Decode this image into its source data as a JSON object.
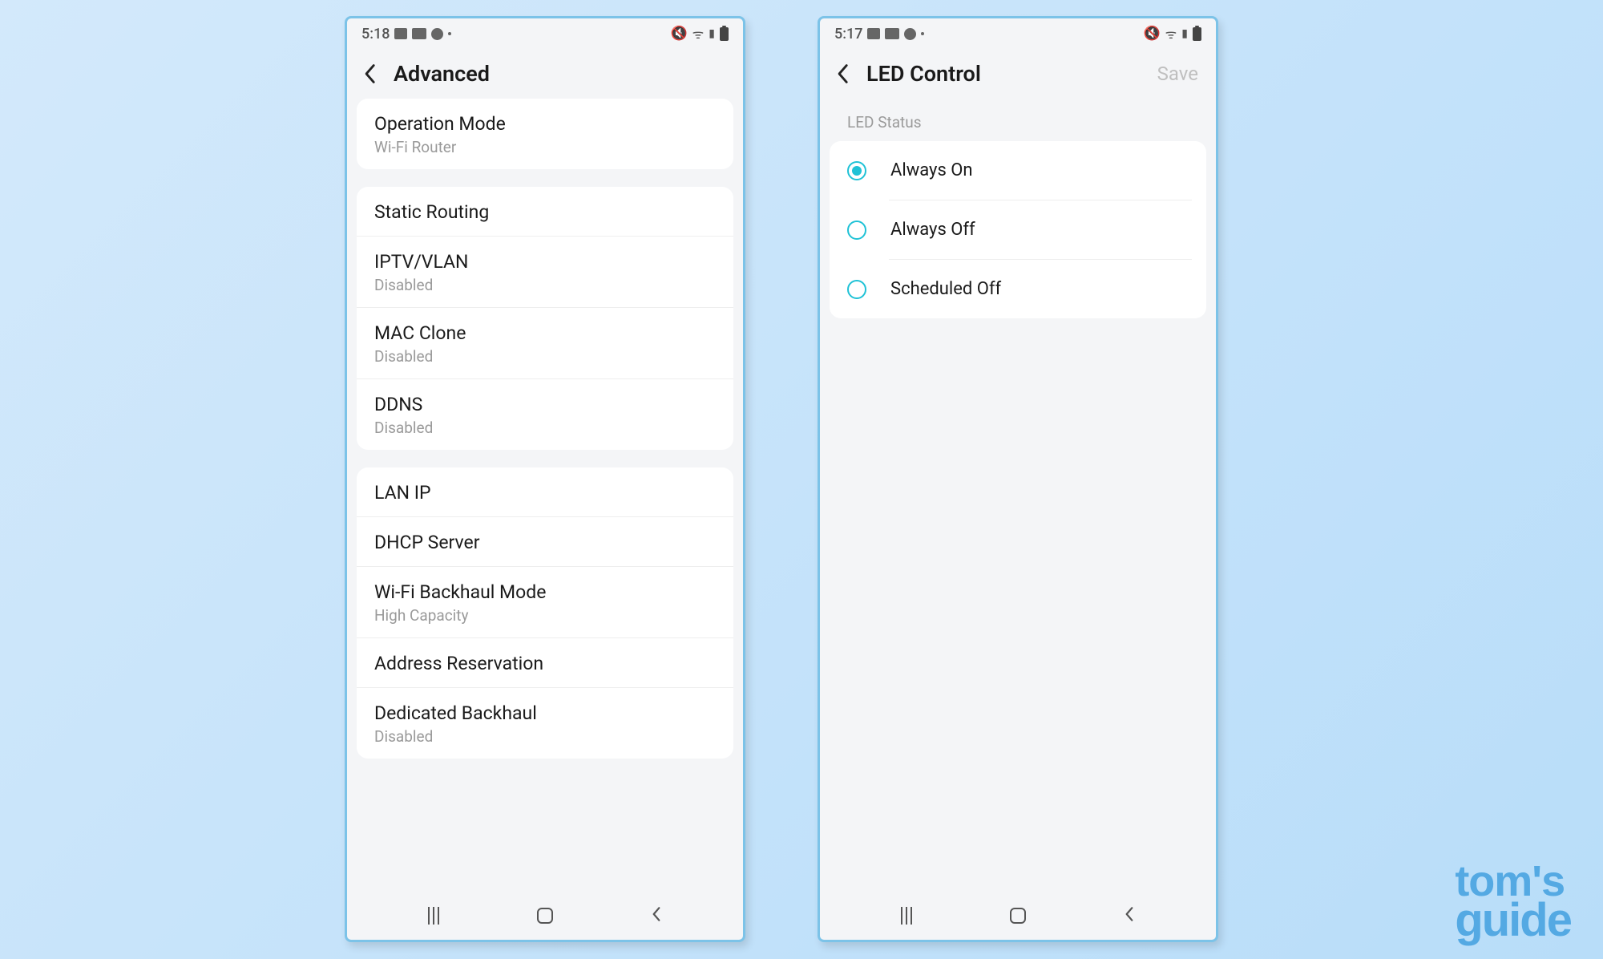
{
  "watermark": {
    "line1": "tom's",
    "line2": "guide"
  },
  "phone_left": {
    "status": {
      "time": "5:18"
    },
    "header": {
      "title": "Advanced"
    },
    "group1": [
      {
        "title": "Operation Mode",
        "sub": "Wi-Fi Router"
      }
    ],
    "group2": [
      {
        "title": "Static Routing",
        "sub": ""
      },
      {
        "title": "IPTV/VLAN",
        "sub": "Disabled"
      },
      {
        "title": "MAC Clone",
        "sub": "Disabled"
      },
      {
        "title": "DDNS",
        "sub": "Disabled"
      }
    ],
    "group3": [
      {
        "title": "LAN IP",
        "sub": ""
      },
      {
        "title": "DHCP Server",
        "sub": ""
      },
      {
        "title": "Wi-Fi Backhaul Mode",
        "sub": "High Capacity"
      },
      {
        "title": "Address Reservation",
        "sub": ""
      },
      {
        "title": "Dedicated Backhaul",
        "sub": "Disabled"
      }
    ]
  },
  "phone_right": {
    "status": {
      "time": "5:17"
    },
    "header": {
      "title": "LED Control",
      "save": "Save"
    },
    "section_label": "LED Status",
    "options": [
      {
        "label": "Always On",
        "selected": true
      },
      {
        "label": "Always Off",
        "selected": false
      },
      {
        "label": "Scheduled Off",
        "selected": false
      }
    ]
  }
}
